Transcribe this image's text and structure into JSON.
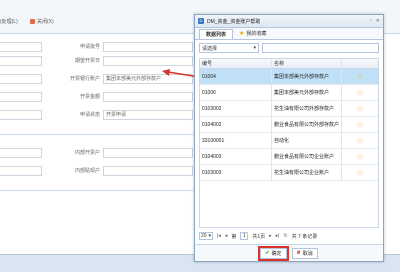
{
  "background": {
    "toolbar": [
      {
        "label": "(处理(L)"
      },
      {
        "label": "关闭(X)"
      }
    ],
    "rows": [
      {
        "left": "",
        "label": "申请批号",
        "right": ""
      },
      {
        "left": "",
        "label": "期望开票日",
        "right": ""
      },
      {
        "left": "",
        "label": "开票银行账户",
        "right": "集团本部美元外部存款户"
      },
      {
        "left": "",
        "label": "开票金额",
        "right": ""
      },
      {
        "left": "",
        "label": "申请状态",
        "right": "开票申请"
      },
      {
        "left": "",
        "label": "内部开票户",
        "right": ""
      },
      {
        "left": "",
        "label": "内部贴现户",
        "right": ""
      }
    ]
  },
  "dialog": {
    "title": "DM_资金_资金账户帮助",
    "controls": {
      "restore": "▫",
      "close": "✕"
    },
    "tabs": [
      "数据列表",
      "我的收藏"
    ],
    "filter": {
      "select": "请选择"
    },
    "grid": {
      "headers": [
        "编号",
        "名称",
        ""
      ],
      "rows": [
        {
          "code": "01004",
          "name": "集团本部美元外部存款户"
        },
        {
          "code": "01006",
          "name": "集团本部美元外部存款户"
        },
        {
          "code": "0103002",
          "name": "花生油有限公司外部存款户"
        },
        {
          "code": "0104002",
          "name": "鹏业食品有限公司外部存款户"
        },
        {
          "code": "33100001",
          "name": "自动化"
        },
        {
          "code": "0104003",
          "name": "鹏业食品有限公司企业账户"
        },
        {
          "code": "0103003",
          "name": "花生油有限公司企业账户"
        }
      ],
      "selected_index": 0
    },
    "pager": {
      "page_size": "20",
      "page_label": "第",
      "page_input": "1",
      "page_total": "共1页",
      "records": "共 7 条记录"
    },
    "buttons": {
      "ok": "确定",
      "cancel": "取消"
    }
  },
  "colors": {
    "selected_row": "#bfe0f7",
    "highlight_outline": "#d9342b",
    "arrow": "#d9342b",
    "star": "#f0b400"
  },
  "icons": {
    "star": "star-icon",
    "ok": "check-icon",
    "cancel": "x-icon",
    "arrow": "arrow-left-icon"
  }
}
